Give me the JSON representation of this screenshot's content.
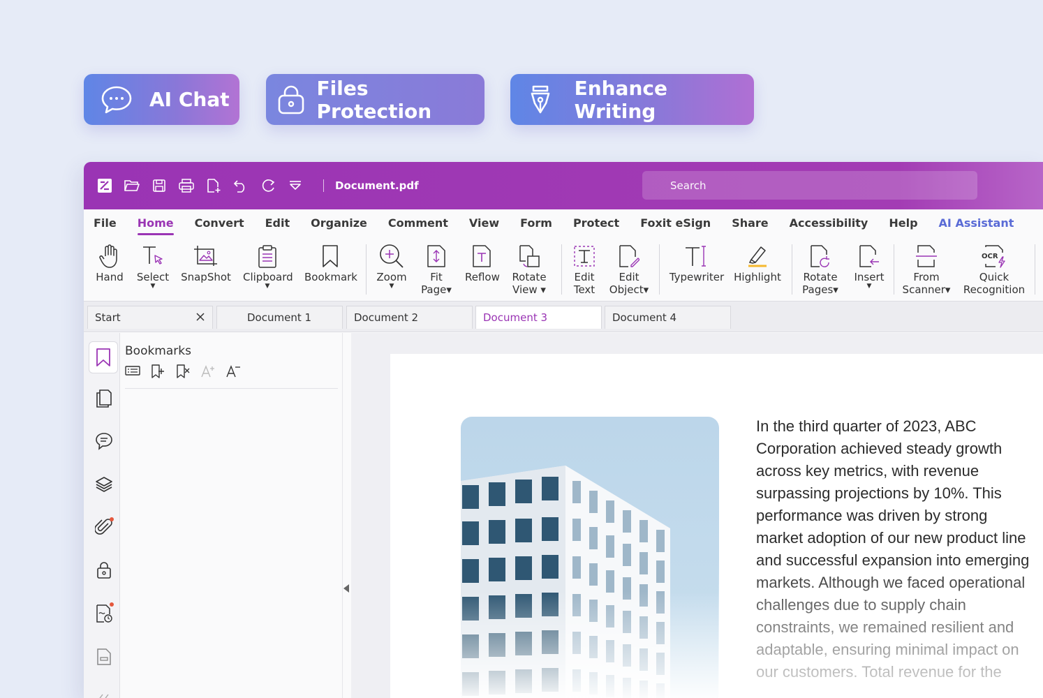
{
  "features": {
    "ai_chat": "AI Chat",
    "files_protection": "Files Protection",
    "enhance_writing": "Enhance Writing"
  },
  "titlebar": {
    "quick_access_icons": [
      "app-logo-icon",
      "open-folder-icon",
      "save-icon",
      "print-icon",
      "new-file-icon",
      "undo-icon",
      "redo-icon",
      "customize-dropdown-icon"
    ],
    "document_title": "Document.pdf",
    "search_placeholder": "Search"
  },
  "menu": {
    "items": [
      "File",
      "Home",
      "Convert",
      "Edit",
      "Organize",
      "Comment",
      "View",
      "Form",
      "Protect",
      "Foxit eSign",
      "Share",
      "Accessibility",
      "Help",
      "AI Assistant"
    ],
    "active": "Home"
  },
  "ribbon": {
    "hand": "Hand",
    "select": "Select",
    "snapshot": "SnapShot",
    "clipboard": "Clipboard",
    "bookmark": "Bookmark",
    "zoom": "Zoom",
    "fit_page_1": "Fit",
    "fit_page_2": "Page",
    "reflow": "Reflow",
    "rotate_view_1": "Rotate",
    "rotate_view_2": "View",
    "edit_text_1": "Edit",
    "edit_text_2": "Text",
    "edit_object_1": "Edit",
    "edit_object_2": "Object",
    "typewriter": "Typewriter",
    "highlight": "Highlight",
    "rotate_pages_1": "Rotate",
    "rotate_pages_2": "Pages",
    "insert": "Insert",
    "from_scanner_1": "From",
    "from_scanner_2": "Scanner",
    "quick_recognition_1": "Quick",
    "quick_recognition_2": "Recognition",
    "ocr_badge": "OCR"
  },
  "tabs": {
    "start": "Start",
    "doc1": "Document 1",
    "doc2": "Document 2",
    "doc3": "Document 3",
    "doc4": "Document 4",
    "active": "Document 3"
  },
  "bookmarks_panel": {
    "title": "Bookmarks"
  },
  "document": {
    "paragraph": "In the third quarter of 2023, ABC Corporation achieved steady growth across key metrics, with revenue surpassing projections by 10%. This performance was driven by strong market adoption of our new product line and successful expansion into emerging markets. Although we faced operational challenges due to supply chain constraints, we remained resilient and adaptable, ensuring minimal impact on our customers. Total revenue for the"
  },
  "colors": {
    "brand_purple": "#9a34b4",
    "ai_blue": "#5a6bd6",
    "background": "#e6ebf7"
  }
}
